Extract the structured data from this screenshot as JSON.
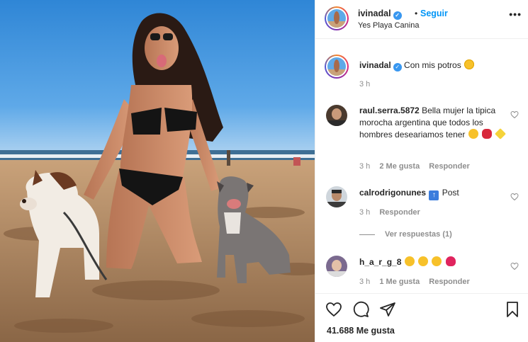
{
  "post": {
    "author": "ivinadal",
    "follow_label": "Seguir",
    "location": "Yes Playa Canina",
    "more_label": "•••",
    "caption": "Con mis potros",
    "caption_time": "3 h",
    "likes": "41.688 Me gusta"
  },
  "comments": [
    {
      "user": "raul.serra.5872",
      "text": "Bella mujer la tipica morocha argentina que todos los hombres deseariamos tener",
      "time": "3 h",
      "likes": "2 Me gusta",
      "reply": "Responder"
    },
    {
      "user": "calrodrigonunes",
      "text": "Post",
      "time": "3 h",
      "reply": "Responder",
      "view_replies": "Ver respuestas (1)"
    },
    {
      "user": "h_a_r_g_8",
      "text": "",
      "time": "3 h",
      "likes": "1 Me gusta",
      "reply": "Responder"
    }
  ],
  "colors": {
    "accent": "#0095f6",
    "verified": "#3897f0",
    "muted": "#8e8e8e",
    "text": "#262626"
  },
  "icons": [
    "heart-icon",
    "comment-icon",
    "share-icon",
    "bookmark-icon",
    "verified-badge-icon",
    "more-options-icon"
  ]
}
